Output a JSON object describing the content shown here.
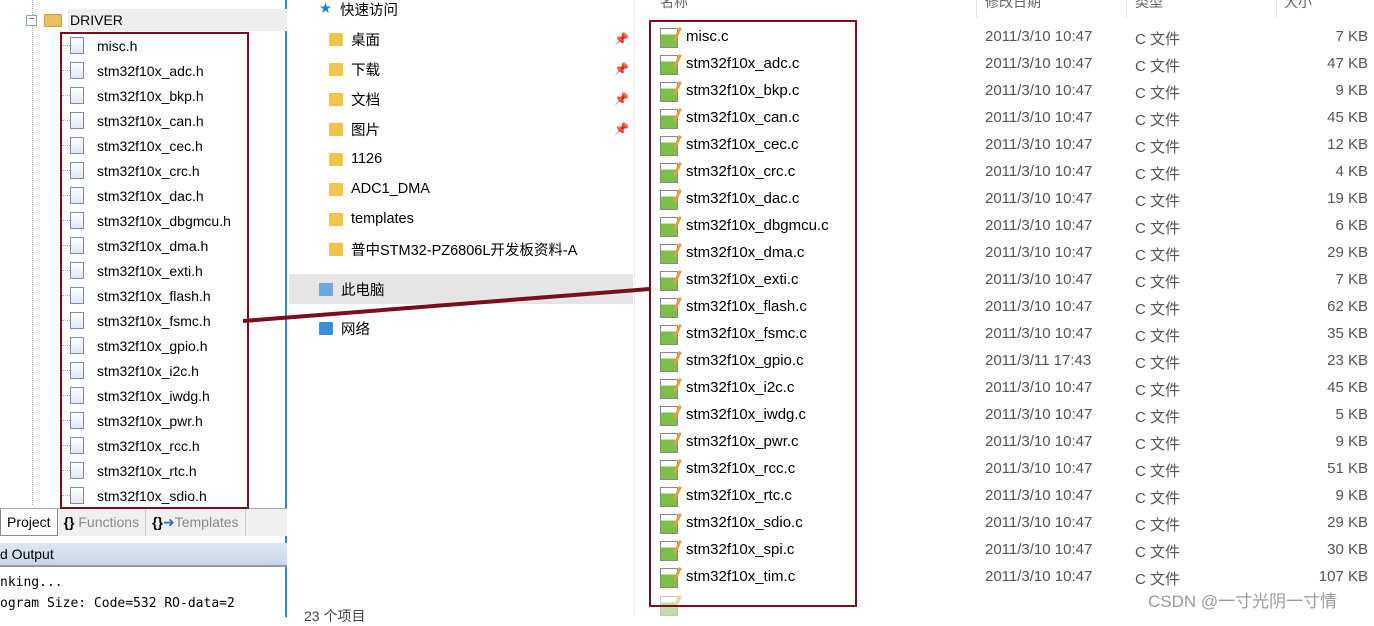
{
  "project_tree": {
    "folder": "DRIVER",
    "files": [
      "misc.h",
      "stm32f10x_adc.h",
      "stm32f10x_bkp.h",
      "stm32f10x_can.h",
      "stm32f10x_cec.h",
      "stm32f10x_crc.h",
      "stm32f10x_dac.h",
      "stm32f10x_dbgmcu.h",
      "stm32f10x_dma.h",
      "stm32f10x_exti.h",
      "stm32f10x_flash.h",
      "stm32f10x_fsmc.h",
      "stm32f10x_gpio.h",
      "stm32f10x_i2c.h",
      "stm32f10x_iwdg.h",
      "stm32f10x_pwr.h",
      "stm32f10x_rcc.h",
      "stm32f10x_rtc.h",
      "stm32f10x_sdio.h"
    ]
  },
  "tabs": [
    {
      "label": "Project"
    },
    {
      "label": "Functions",
      "icon": "braces-icon"
    },
    {
      "label": "Templates",
      "icon": "template-icon"
    }
  ],
  "output": {
    "title": "d Output",
    "lines": [
      "nking...",
      "ogram Size: Code=532 RO-data=2"
    ]
  },
  "nav": {
    "items": [
      {
        "label": "快速访问",
        "icon": "star-icon"
      },
      {
        "label": "桌面",
        "pinned": true
      },
      {
        "label": "下载",
        "pinned": true
      },
      {
        "label": "文档",
        "pinned": true
      },
      {
        "label": "图片",
        "pinned": true
      },
      {
        "label": "1126"
      },
      {
        "label": "ADC1_DMA"
      },
      {
        "label": "templates"
      },
      {
        "label": "普中STM32-PZ6806L开发板资料-A"
      },
      {
        "label": "此电脑",
        "selected": true
      },
      {
        "label": "网络"
      }
    ]
  },
  "columns": {
    "name": "名称",
    "date": "修改日期",
    "type": "类型",
    "size": "大小"
  },
  "files": [
    {
      "name": "misc.c",
      "date": "2011/3/10 10:47",
      "type": "C 文件",
      "size": "7 KB"
    },
    {
      "name": "stm32f10x_adc.c",
      "date": "2011/3/10 10:47",
      "type": "C 文件",
      "size": "47 KB"
    },
    {
      "name": "stm32f10x_bkp.c",
      "date": "2011/3/10 10:47",
      "type": "C 文件",
      "size": "9 KB"
    },
    {
      "name": "stm32f10x_can.c",
      "date": "2011/3/10 10:47",
      "type": "C 文件",
      "size": "45 KB"
    },
    {
      "name": "stm32f10x_cec.c",
      "date": "2011/3/10 10:47",
      "type": "C 文件",
      "size": "12 KB"
    },
    {
      "name": "stm32f10x_crc.c",
      "date": "2011/3/10 10:47",
      "type": "C 文件",
      "size": "4 KB"
    },
    {
      "name": "stm32f10x_dac.c",
      "date": "2011/3/10 10:47",
      "type": "C 文件",
      "size": "19 KB"
    },
    {
      "name": "stm32f10x_dbgmcu.c",
      "date": "2011/3/10 10:47",
      "type": "C 文件",
      "size": "6 KB"
    },
    {
      "name": "stm32f10x_dma.c",
      "date": "2011/3/10 10:47",
      "type": "C 文件",
      "size": "29 KB"
    },
    {
      "name": "stm32f10x_exti.c",
      "date": "2011/3/10 10:47",
      "type": "C 文件",
      "size": "7 KB"
    },
    {
      "name": "stm32f10x_flash.c",
      "date": "2011/3/10 10:47",
      "type": "C 文件",
      "size": "62 KB"
    },
    {
      "name": "stm32f10x_fsmc.c",
      "date": "2011/3/10 10:47",
      "type": "C 文件",
      "size": "35 KB"
    },
    {
      "name": "stm32f10x_gpio.c",
      "date": "2011/3/11 17:43",
      "type": "C 文件",
      "size": "23 KB"
    },
    {
      "name": "stm32f10x_i2c.c",
      "date": "2011/3/10 10:47",
      "type": "C 文件",
      "size": "45 KB"
    },
    {
      "name": "stm32f10x_iwdg.c",
      "date": "2011/3/10 10:47",
      "type": "C 文件",
      "size": "5 KB"
    },
    {
      "name": "stm32f10x_pwr.c",
      "date": "2011/3/10 10:47",
      "type": "C 文件",
      "size": "9 KB"
    },
    {
      "name": "stm32f10x_rcc.c",
      "date": "2011/3/10 10:47",
      "type": "C 文件",
      "size": "51 KB"
    },
    {
      "name": "stm32f10x_rtc.c",
      "date": "2011/3/10 10:47",
      "type": "C 文件",
      "size": "9 KB"
    },
    {
      "name": "stm32f10x_sdio.c",
      "date": "2011/3/10 10:47",
      "type": "C 文件",
      "size": "29 KB"
    },
    {
      "name": "stm32f10x_spi.c",
      "date": "2011/3/10 10:47",
      "type": "C 文件",
      "size": "30 KB"
    },
    {
      "name": "stm32f10x_tim.c",
      "date": "2011/3/10 10:47",
      "type": "C 文件",
      "size": "107 KB"
    }
  ],
  "status": "23 个项目",
  "watermark": "CSDN @一寸光阴一寸情",
  "colors": {
    "annotation": "#7a0e1e",
    "selection": "#e5e5e5"
  }
}
